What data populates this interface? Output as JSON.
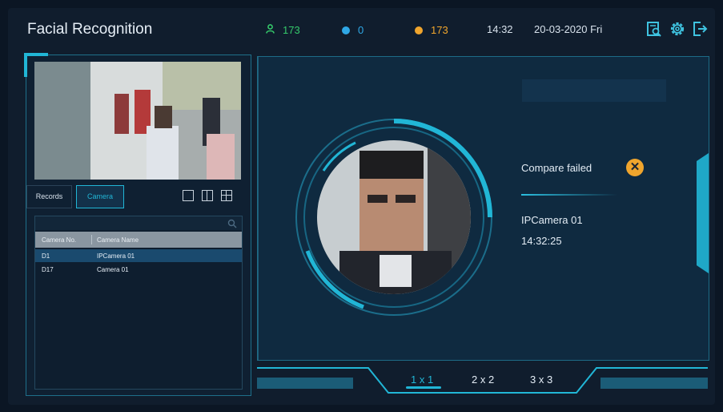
{
  "header": {
    "title": "Facial Recognition",
    "stats": [
      {
        "icon": "person-icon",
        "value": "173",
        "color": "#34c86a"
      },
      {
        "icon": "check-circle-icon",
        "value": "0",
        "color": "#2fa8e6"
      },
      {
        "icon": "warning-circle-icon",
        "value": "173",
        "color": "#f0a52d"
      }
    ],
    "time": "14:32",
    "date": "20-03-2020 Fri",
    "icons": [
      "search-file-icon",
      "gear-icon",
      "logout-icon"
    ]
  },
  "left": {
    "tabs": [
      {
        "label": "Records",
        "active": false
      },
      {
        "label": "Camera",
        "active": true
      }
    ],
    "layout_icons": [
      "single-view-icon",
      "dual-view-icon",
      "quad-view-icon"
    ],
    "table": {
      "headers": [
        "Camera No.",
        "Camera Name"
      ],
      "rows": [
        {
          "no": "D1",
          "name": "IPCamera 01",
          "selected": true
        },
        {
          "no": "D17",
          "name": "Camera 01",
          "selected": false
        }
      ]
    }
  },
  "result": {
    "status": "Compare failed",
    "camera": "IPCamera 01",
    "time": "14:32:25"
  },
  "pager": {
    "options": [
      {
        "label": "1 x 1",
        "active": true
      },
      {
        "label": "2 x 2",
        "active": false
      },
      {
        "label": "3 x 3",
        "active": false
      }
    ]
  },
  "colors": {
    "accent": "#21b6d6",
    "bg": "#101d2d",
    "selected_row": "#1a4a6e",
    "warning": "#f0a52d"
  }
}
